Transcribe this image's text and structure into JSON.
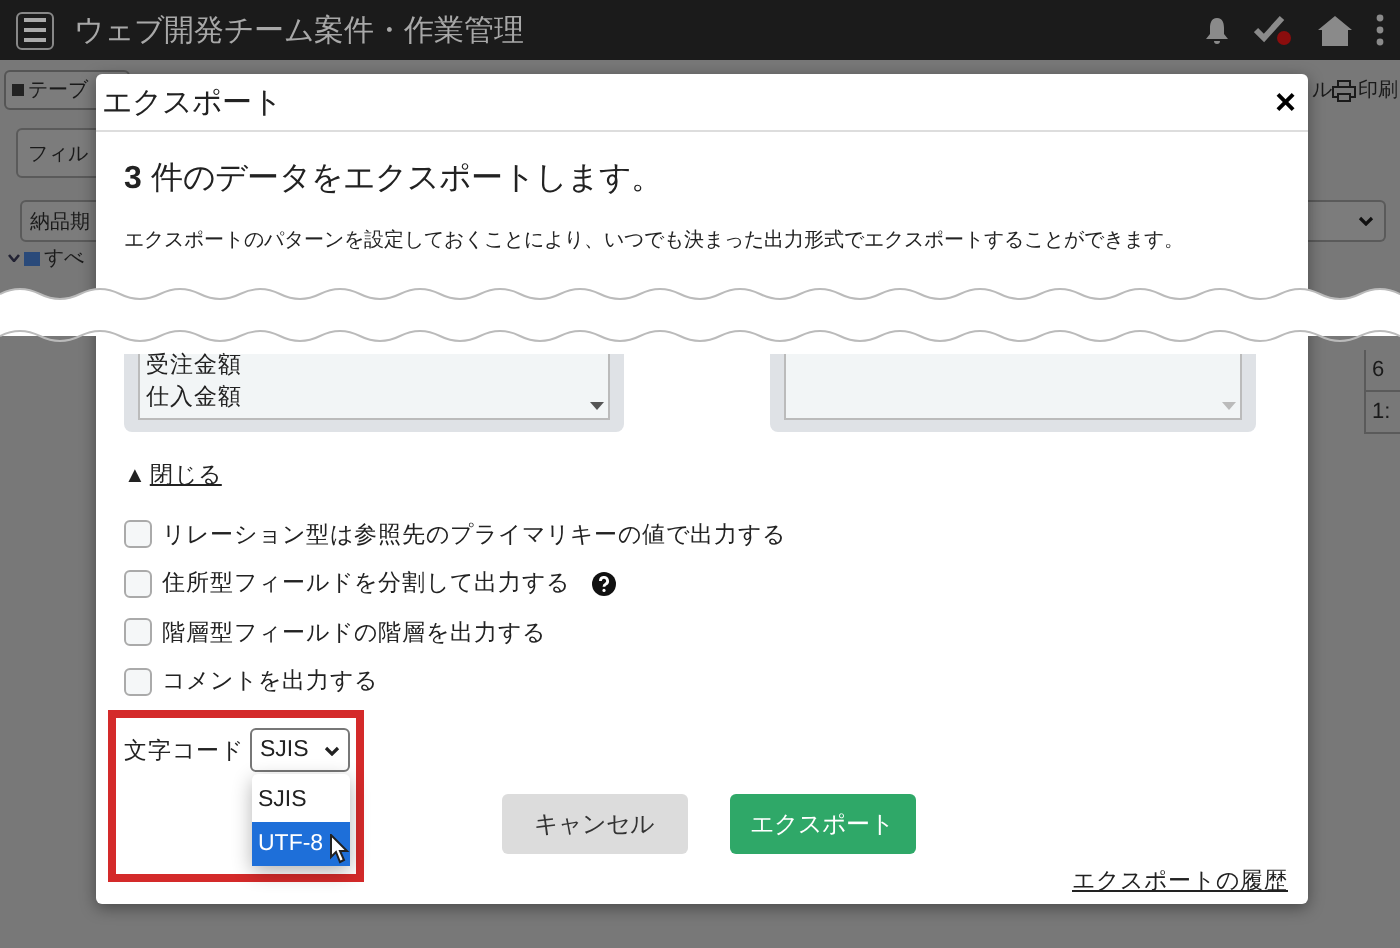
{
  "app_header": {
    "title": "ウェブ開発チーム案件・作業管理"
  },
  "background": {
    "table_button": "テーブ",
    "right_text": "ル",
    "print_button": "印刷",
    "filter_field": "フィル",
    "sort_select": "納品期",
    "tree_item": "すべ",
    "cells": [
      "6",
      "1:"
    ]
  },
  "dialog": {
    "title": "エクスポート",
    "close": "×",
    "summary": "**3** 件のデータをエクスポートします。",
    "description": "エクスポートのパターンを設定しておくことにより、いつでも決まった出力形式でエクスポートすることができます。",
    "field_list": {
      "items": [
        "受注金額",
        "仕入金額"
      ]
    },
    "toggle": {
      "arrow": "▲",
      "label": "閉じる"
    },
    "options": [
      {
        "label": "リレーション型は参照先のプライマリキーの値で出力する",
        "checked": false,
        "help": false
      },
      {
        "label": "住所型フィールドを分割して出力する",
        "checked": false,
        "help": true
      },
      {
        "label": "階層型フィールドの階層を出力する",
        "checked": false,
        "help": false
      },
      {
        "label": "コメントを出力する",
        "checked": false,
        "help": false
      }
    ],
    "encoding": {
      "label": "文字コード",
      "value": "SJIS",
      "expanded": true,
      "options": [
        {
          "label": "SJIS",
          "highlighted": false
        },
        {
          "label": "UTF-8",
          "highlighted": true
        }
      ]
    },
    "buttons": [
      {
        "label": "キャンセル",
        "kind": "secondary"
      },
      {
        "label": "エクスポート",
        "kind": "primary"
      }
    ],
    "history_link": "エクスポートの履歴"
  }
}
